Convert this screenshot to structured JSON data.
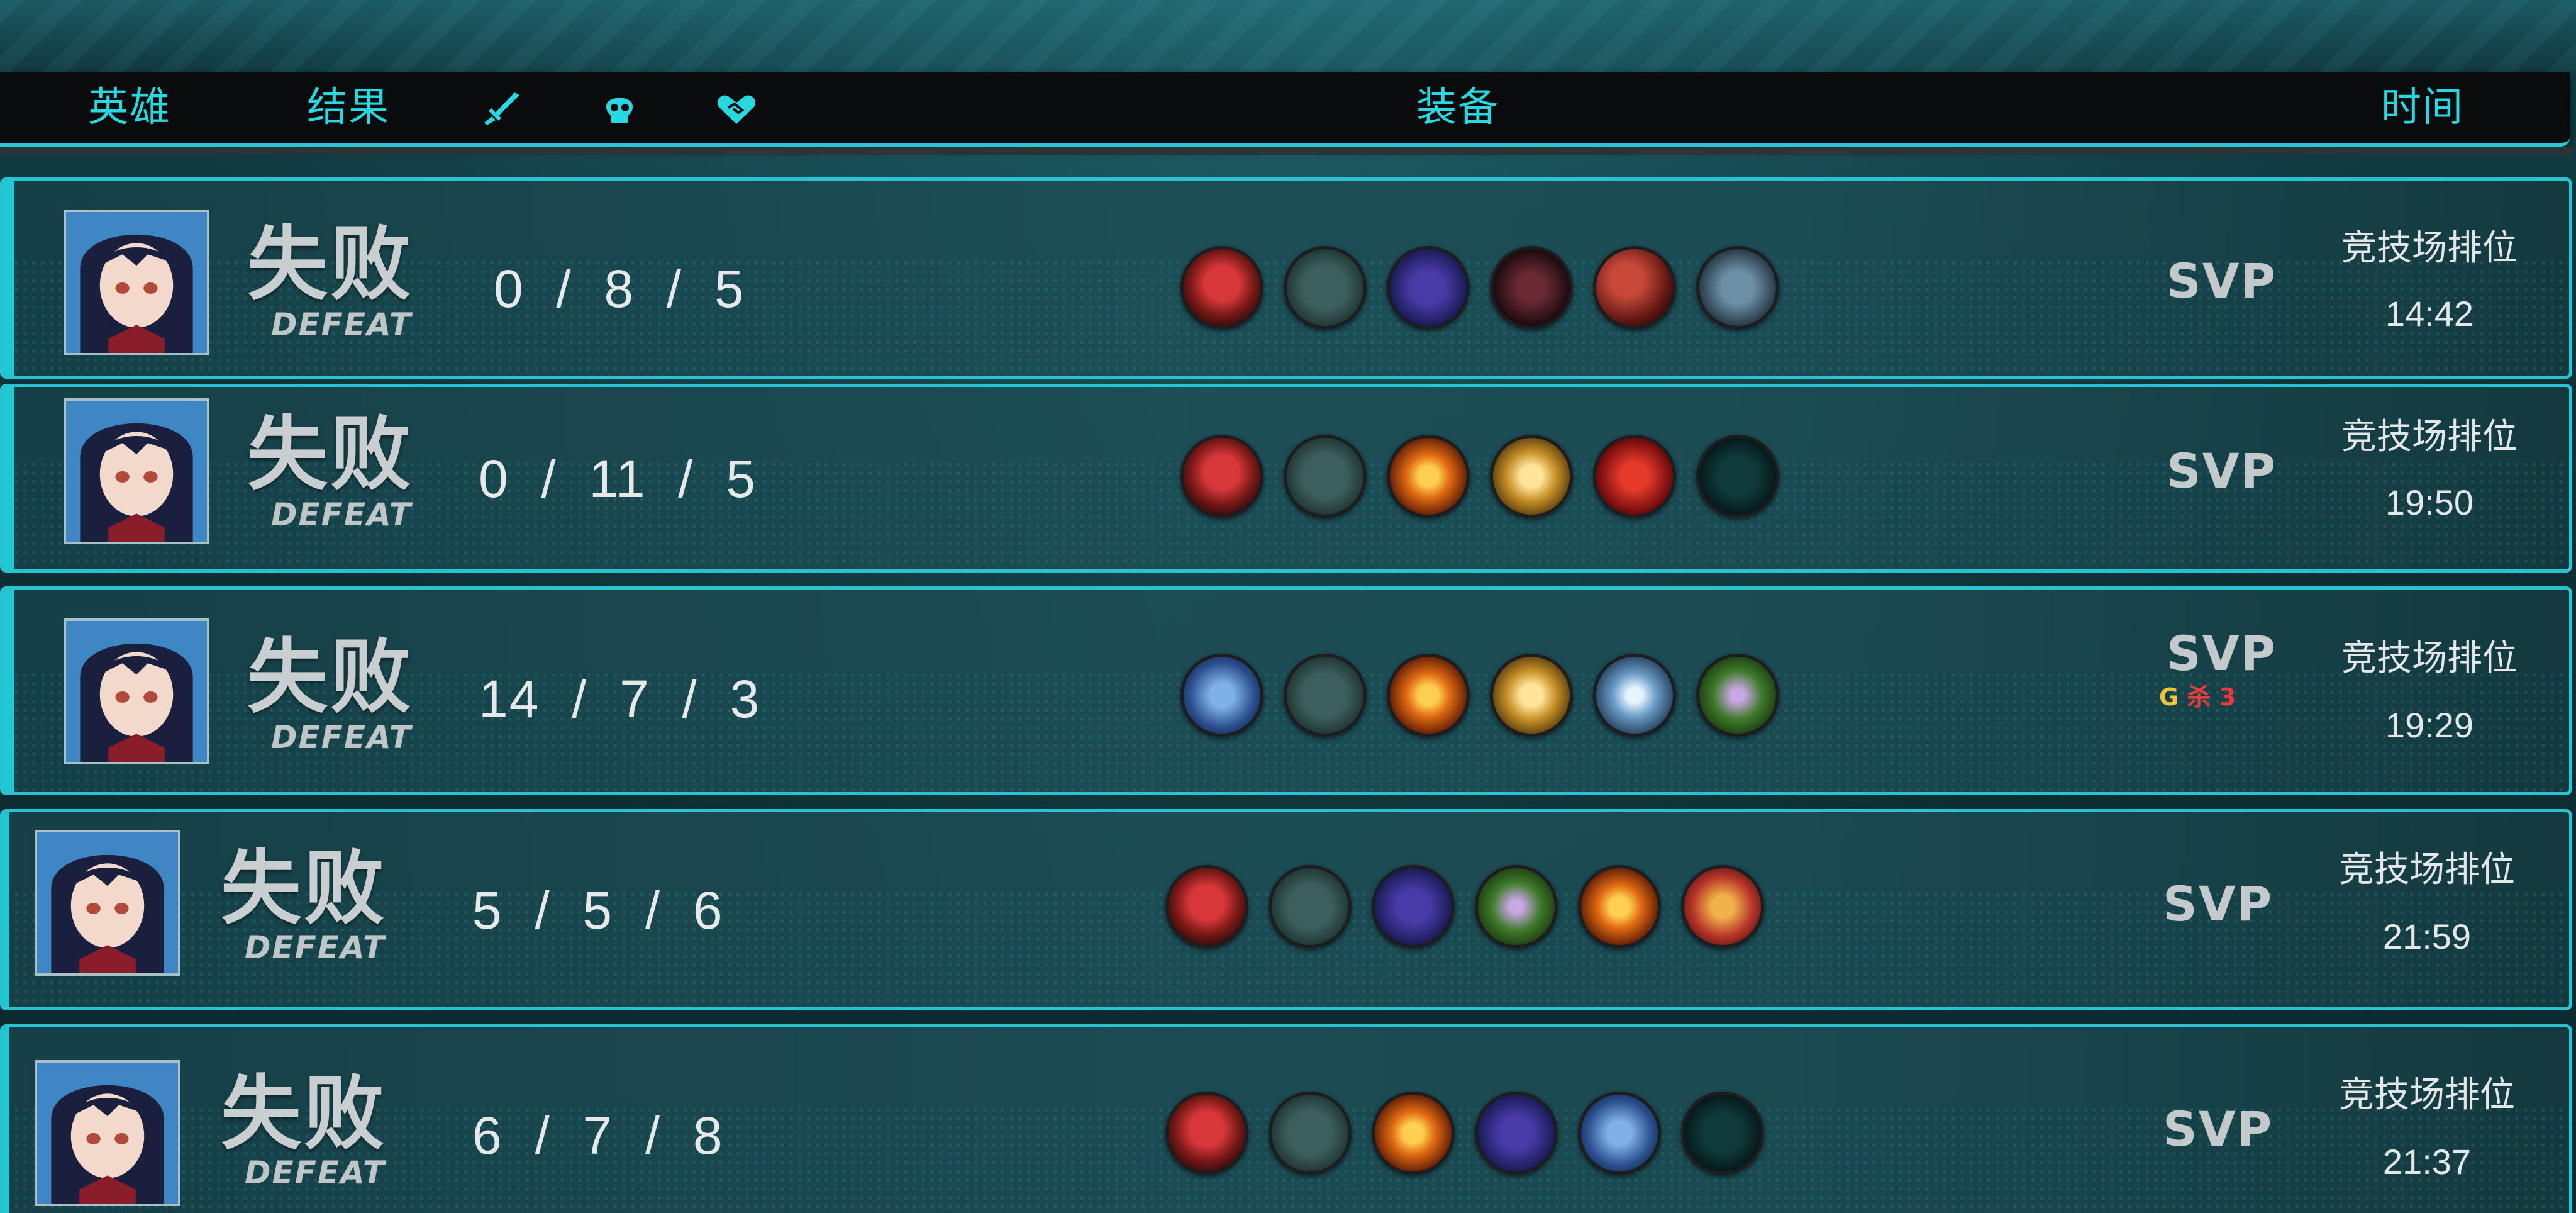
{
  "header": {
    "hero_label": "英雄",
    "result_label": "结果",
    "kills_icon": "dagger-icon",
    "deaths_icon": "skull-icon",
    "assists_icon": "handshake-heart-icon",
    "equipment_label": "装备",
    "time_label": "时间"
  },
  "colors": {
    "accent": "#29d7e0",
    "border": "#28c3ce",
    "header_bg": "#0a0b0d",
    "badge_gold": "#f0c23a",
    "badge_red": "#ee3a3a"
  },
  "matches": [
    {
      "result_cn": "失败",
      "result_en": "DEFEAT",
      "kda": "0  /  8  /  5",
      "items": [
        "red-boots-icon",
        "plane-blade-icon",
        "purple-claw-icon",
        "chain-whip-icon",
        "scarlet-blade-icon",
        "steel-ring-icon"
      ],
      "rating": "SVP",
      "badge": null,
      "mode": "竞技场排位",
      "time": "14:42"
    },
    {
      "result_cn": "失败",
      "result_en": "DEFEAT",
      "kda": "0  /  11  /  5",
      "items": [
        "red-boots-icon",
        "plane-blade-icon",
        "fire-sword-icon",
        "gold-cross-icon",
        "dragon-armor-icon",
        "empty-slot-icon"
      ],
      "rating": "SVP",
      "badge": null,
      "mode": "竞技场排位",
      "time": "19:50"
    },
    {
      "result_cn": "失败",
      "result_en": "DEFEAT",
      "kda": "14  /  7  /  3",
      "items": [
        "blue-blade-icon",
        "plane-blade-icon",
        "fire-sword-icon",
        "gold-cross-icon",
        "ice-shard-icon",
        "green-thorn-icon"
      ],
      "rating": "SVP",
      "badge": {
        "g": "G",
        "r": "杀 3"
      },
      "mode": "竞技场排位",
      "time": "19:29"
    },
    {
      "result_cn": "失败",
      "result_en": "DEFEAT",
      "kda": "5  /  5  /  6",
      "items": [
        "red-boots-icon",
        "plane-blade-icon",
        "purple-claw-icon",
        "green-thorn-icon",
        "fire-sword-icon",
        "cross-blades-icon"
      ],
      "rating": "SVP",
      "badge": null,
      "mode": "竞技场排位",
      "time": "21:59"
    },
    {
      "result_cn": "失败",
      "result_en": "DEFEAT",
      "kda": "6  /  7  /  8",
      "items": [
        "red-boots-icon",
        "plane-blade-icon",
        "fire-sword-icon",
        "purple-claw-icon",
        "blue-blade-icon",
        "empty-slot-icon"
      ],
      "rating": "SVP",
      "badge": null,
      "mode": "竞技场排位",
      "time": "21:37"
    }
  ]
}
